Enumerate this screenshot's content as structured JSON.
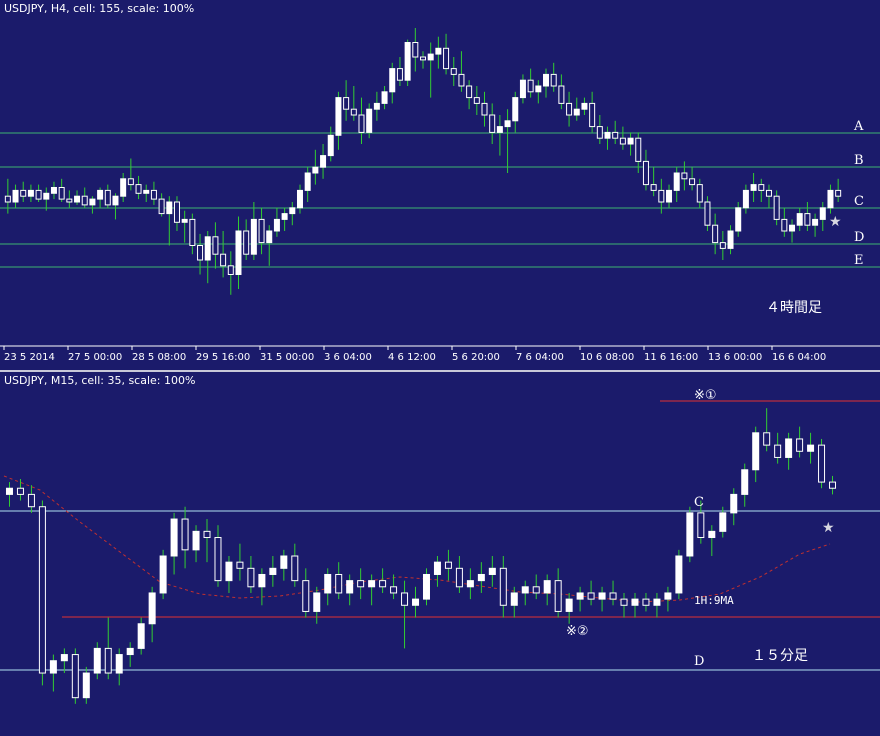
{
  "top": {
    "title": "USDJPY, H4, cell: 155, scale: 100%",
    "timeframe_label": "４時間足",
    "star": "★",
    "time_labels": [
      "23 5 2014",
      "27 5 00:00",
      "28 5 08:00",
      "29 5 16:00",
      "31 5 00:00",
      "3 6 04:00",
      "4 6 12:00",
      "5 6 20:00",
      "7 6 04:00",
      "10 6 08:00",
      "11 6 16:00",
      "13 6 00:00",
      "16 6 04:00"
    ],
    "levels": [
      {
        "label": "A",
        "color": "#3cb371"
      },
      {
        "label": "B",
        "color": "#3cb371"
      },
      {
        "label": "C",
        "color": "#3cb371"
      },
      {
        "label": "D",
        "color": "#3cb371"
      },
      {
        "label": "E",
        "color": "#3cb371"
      }
    ],
    "colors": {
      "up": "#ffffff",
      "down": "#ffffff",
      "wick": "#32cd32"
    }
  },
  "bottom": {
    "title": "USDJPY, M15, cell: 35, scale: 100%",
    "timeframe_label": "１５分足",
    "ma_label": "1H:9MA",
    "mark1": "※①",
    "mark2": "※②",
    "star": "★",
    "level_c": "C",
    "level_d": "D",
    "colors": {
      "level": "#b0e0f0",
      "red": "#e03030",
      "ma": "#c03030"
    }
  },
  "chart_data": [
    {
      "type": "candlestick",
      "title": "USDJPY, H4, cell: 155, scale: 100%",
      "x_tick_labels": [
        "23 5 2014",
        "27 5 00:00",
        "28 5 08:00",
        "29 5 16:00",
        "31 5 00:00",
        "3 6 04:00",
        "4 6 12:00",
        "5 6 20:00",
        "7 6 04:00",
        "10 6 08:00",
        "11 6 16:00",
        "13 6 00:00",
        "16 6 04:00"
      ],
      "horizontal_levels": [
        "A",
        "B",
        "C",
        "D",
        "E"
      ],
      "candles_ohlc_relative": [
        [
          0.42,
          0.48,
          0.36,
          0.4
        ],
        [
          0.4,
          0.46,
          0.38,
          0.44
        ],
        [
          0.44,
          0.47,
          0.4,
          0.42
        ],
        [
          0.42,
          0.46,
          0.4,
          0.44
        ],
        [
          0.44,
          0.46,
          0.4,
          0.41
        ],
        [
          0.41,
          0.45,
          0.37,
          0.43
        ],
        [
          0.43,
          0.47,
          0.41,
          0.45
        ],
        [
          0.45,
          0.48,
          0.4,
          0.41
        ],
        [
          0.41,
          0.44,
          0.38,
          0.4
        ],
        [
          0.4,
          0.44,
          0.39,
          0.42
        ],
        [
          0.42,
          0.45,
          0.38,
          0.39
        ],
        [
          0.39,
          0.42,
          0.36,
          0.41
        ],
        [
          0.41,
          0.45,
          0.38,
          0.44
        ],
        [
          0.44,
          0.46,
          0.38,
          0.39
        ],
        [
          0.39,
          0.43,
          0.34,
          0.42
        ],
        [
          0.42,
          0.5,
          0.4,
          0.48
        ],
        [
          0.48,
          0.55,
          0.44,
          0.46
        ],
        [
          0.46,
          0.49,
          0.41,
          0.43
        ],
        [
          0.43,
          0.46,
          0.4,
          0.44
        ],
        [
          0.44,
          0.47,
          0.39,
          0.41
        ],
        [
          0.41,
          0.43,
          0.35,
          0.36
        ],
        [
          0.36,
          0.42,
          0.25,
          0.4
        ],
        [
          0.4,
          0.42,
          0.3,
          0.33
        ],
        [
          0.33,
          0.37,
          0.26,
          0.34
        ],
        [
          0.34,
          0.36,
          0.22,
          0.25
        ],
        [
          0.25,
          0.29,
          0.15,
          0.2
        ],
        [
          0.2,
          0.3,
          0.12,
          0.28
        ],
        [
          0.28,
          0.33,
          0.17,
          0.22
        ],
        [
          0.22,
          0.3,
          0.14,
          0.18
        ],
        [
          0.18,
          0.23,
          0.08,
          0.15
        ],
        [
          0.15,
          0.35,
          0.1,
          0.3
        ],
        [
          0.3,
          0.34,
          0.2,
          0.22
        ],
        [
          0.22,
          0.4,
          0.2,
          0.34
        ],
        [
          0.34,
          0.38,
          0.22,
          0.26
        ],
        [
          0.26,
          0.32,
          0.18,
          0.3
        ],
        [
          0.3,
          0.38,
          0.28,
          0.34
        ],
        [
          0.34,
          0.38,
          0.3,
          0.36
        ],
        [
          0.36,
          0.4,
          0.32,
          0.38
        ],
        [
          0.38,
          0.46,
          0.36,
          0.44
        ],
        [
          0.44,
          0.52,
          0.4,
          0.5
        ],
        [
          0.5,
          0.58,
          0.46,
          0.52
        ],
        [
          0.52,
          0.6,
          0.48,
          0.56
        ],
        [
          0.56,
          0.66,
          0.54,
          0.63
        ],
        [
          0.63,
          0.78,
          0.58,
          0.76
        ],
        [
          0.76,
          0.82,
          0.68,
          0.72
        ],
        [
          0.72,
          0.8,
          0.68,
          0.7
        ],
        [
          0.7,
          0.76,
          0.6,
          0.64
        ],
        [
          0.64,
          0.74,
          0.62,
          0.72
        ],
        [
          0.72,
          0.78,
          0.68,
          0.74
        ],
        [
          0.74,
          0.8,
          0.72,
          0.78
        ],
        [
          0.78,
          0.88,
          0.74,
          0.86
        ],
        [
          0.86,
          0.9,
          0.8,
          0.82
        ],
        [
          0.82,
          0.96,
          0.8,
          0.95
        ],
        [
          0.95,
          1.0,
          0.85,
          0.9
        ],
        [
          0.9,
          0.92,
          0.86,
          0.89
        ],
        [
          0.89,
          0.95,
          0.76,
          0.91
        ],
        [
          0.91,
          0.97,
          0.86,
          0.93
        ],
        [
          0.93,
          0.98,
          0.84,
          0.86
        ],
        [
          0.86,
          0.9,
          0.8,
          0.84
        ],
        [
          0.84,
          0.92,
          0.78,
          0.8
        ],
        [
          0.8,
          0.82,
          0.72,
          0.76
        ],
        [
          0.76,
          0.8,
          0.7,
          0.74
        ],
        [
          0.74,
          0.78,
          0.66,
          0.7
        ],
        [
          0.7,
          0.74,
          0.6,
          0.64
        ],
        [
          0.64,
          0.7,
          0.56,
          0.66
        ],
        [
          0.66,
          0.72,
          0.5,
          0.68
        ],
        [
          0.68,
          0.78,
          0.64,
          0.76
        ],
        [
          0.76,
          0.84,
          0.74,
          0.82
        ],
        [
          0.82,
          0.86,
          0.76,
          0.78
        ],
        [
          0.78,
          0.82,
          0.74,
          0.8
        ],
        [
          0.8,
          0.86,
          0.76,
          0.84
        ],
        [
          0.84,
          0.88,
          0.78,
          0.8
        ],
        [
          0.8,
          0.84,
          0.72,
          0.74
        ],
        [
          0.74,
          0.78,
          0.66,
          0.7
        ],
        [
          0.7,
          0.76,
          0.68,
          0.72
        ],
        [
          0.72,
          0.76,
          0.7,
          0.74
        ],
        [
          0.74,
          0.78,
          0.64,
          0.66
        ],
        [
          0.66,
          0.7,
          0.6,
          0.62
        ],
        [
          0.62,
          0.66,
          0.58,
          0.64
        ],
        [
          0.64,
          0.68,
          0.6,
          0.62
        ],
        [
          0.62,
          0.66,
          0.58,
          0.6
        ],
        [
          0.6,
          0.64,
          0.56,
          0.62
        ],
        [
          0.62,
          0.64,
          0.5,
          0.54
        ],
        [
          0.54,
          0.58,
          0.44,
          0.46
        ],
        [
          0.46,
          0.52,
          0.42,
          0.44
        ],
        [
          0.44,
          0.48,
          0.36,
          0.4
        ],
        [
          0.4,
          0.46,
          0.38,
          0.44
        ],
        [
          0.44,
          0.52,
          0.4,
          0.5
        ],
        [
          0.5,
          0.54,
          0.44,
          0.48
        ],
        [
          0.48,
          0.52,
          0.44,
          0.46
        ],
        [
          0.46,
          0.48,
          0.38,
          0.4
        ],
        [
          0.4,
          0.42,
          0.3,
          0.32
        ],
        [
          0.32,
          0.36,
          0.22,
          0.26
        ],
        [
          0.26,
          0.3,
          0.2,
          0.24
        ],
        [
          0.24,
          0.32,
          0.22,
          0.3
        ],
        [
          0.3,
          0.4,
          0.28,
          0.38
        ],
        [
          0.38,
          0.46,
          0.36,
          0.44
        ],
        [
          0.44,
          0.5,
          0.4,
          0.46
        ],
        [
          0.46,
          0.48,
          0.4,
          0.44
        ],
        [
          0.44,
          0.46,
          0.38,
          0.42
        ],
        [
          0.42,
          0.44,
          0.32,
          0.34
        ],
        [
          0.34,
          0.38,
          0.28,
          0.3
        ],
        [
          0.3,
          0.34,
          0.26,
          0.32
        ],
        [
          0.32,
          0.38,
          0.3,
          0.36
        ],
        [
          0.36,
          0.4,
          0.3,
          0.32
        ],
        [
          0.32,
          0.36,
          0.28,
          0.34
        ],
        [
          0.34,
          0.4,
          0.3,
          0.38
        ],
        [
          0.38,
          0.46,
          0.36,
          0.44
        ],
        [
          0.44,
          0.48,
          0.4,
          0.42
        ]
      ]
    },
    {
      "type": "candlestick",
      "title": "USDJPY, M15, cell: 35, scale: 100%",
      "annotations": [
        "※①",
        "※②",
        "1H:9MA",
        "C",
        "D",
        "★",
        "１５分足"
      ],
      "candles_ohlc_relative": [
        [
          0.7,
          0.74,
          0.66,
          0.72
        ],
        [
          0.72,
          0.75,
          0.68,
          0.7
        ],
        [
          0.7,
          0.73,
          0.64,
          0.66
        ],
        [
          0.66,
          0.68,
          0.08,
          0.12
        ],
        [
          0.12,
          0.18,
          0.06,
          0.16
        ],
        [
          0.16,
          0.2,
          0.12,
          0.18
        ],
        [
          0.18,
          0.2,
          0.02,
          0.04
        ],
        [
          0.04,
          0.14,
          0.02,
          0.12
        ],
        [
          0.12,
          0.22,
          0.1,
          0.2
        ],
        [
          0.2,
          0.3,
          0.1,
          0.12
        ],
        [
          0.12,
          0.2,
          0.08,
          0.18
        ],
        [
          0.18,
          0.22,
          0.14,
          0.2
        ],
        [
          0.2,
          0.3,
          0.18,
          0.28
        ],
        [
          0.28,
          0.4,
          0.22,
          0.38
        ],
        [
          0.38,
          0.52,
          0.36,
          0.5
        ],
        [
          0.5,
          0.64,
          0.44,
          0.62
        ],
        [
          0.62,
          0.66,
          0.46,
          0.52
        ],
        [
          0.52,
          0.6,
          0.48,
          0.58
        ],
        [
          0.58,
          0.62,
          0.48,
          0.56
        ],
        [
          0.56,
          0.6,
          0.4,
          0.42
        ],
        [
          0.42,
          0.5,
          0.38,
          0.48
        ],
        [
          0.48,
          0.54,
          0.42,
          0.46
        ],
        [
          0.46,
          0.5,
          0.38,
          0.4
        ],
        [
          0.4,
          0.46,
          0.34,
          0.44
        ],
        [
          0.44,
          0.5,
          0.4,
          0.46
        ],
        [
          0.46,
          0.52,
          0.42,
          0.5
        ],
        [
          0.5,
          0.54,
          0.4,
          0.42
        ],
        [
          0.42,
          0.46,
          0.3,
          0.32
        ],
        [
          0.32,
          0.4,
          0.28,
          0.38
        ],
        [
          0.38,
          0.46,
          0.34,
          0.44
        ],
        [
          0.44,
          0.48,
          0.36,
          0.38
        ],
        [
          0.38,
          0.44,
          0.34,
          0.42
        ],
        [
          0.42,
          0.46,
          0.36,
          0.4
        ],
        [
          0.4,
          0.44,
          0.34,
          0.42
        ],
        [
          0.42,
          0.46,
          0.38,
          0.4
        ],
        [
          0.4,
          0.44,
          0.36,
          0.38
        ],
        [
          0.38,
          0.42,
          0.2,
          0.34
        ],
        [
          0.34,
          0.4,
          0.3,
          0.36
        ],
        [
          0.36,
          0.46,
          0.34,
          0.44
        ],
        [
          0.44,
          0.5,
          0.4,
          0.48
        ],
        [
          0.48,
          0.52,
          0.42,
          0.46
        ],
        [
          0.46,
          0.5,
          0.38,
          0.4
        ],
        [
          0.4,
          0.46,
          0.36,
          0.42
        ],
        [
          0.42,
          0.48,
          0.38,
          0.44
        ],
        [
          0.44,
          0.5,
          0.4,
          0.46
        ],
        [
          0.46,
          0.5,
          0.3,
          0.34
        ],
        [
          0.34,
          0.4,
          0.3,
          0.38
        ],
        [
          0.38,
          0.42,
          0.34,
          0.4
        ],
        [
          0.4,
          0.44,
          0.36,
          0.38
        ],
        [
          0.38,
          0.44,
          0.34,
          0.42
        ],
        [
          0.42,
          0.46,
          0.3,
          0.32
        ],
        [
          0.32,
          0.38,
          0.28,
          0.36
        ],
        [
          0.36,
          0.4,
          0.32,
          0.38
        ],
        [
          0.38,
          0.42,
          0.34,
          0.36
        ],
        [
          0.36,
          0.4,
          0.32,
          0.38
        ],
        [
          0.38,
          0.42,
          0.34,
          0.36
        ],
        [
          0.36,
          0.38,
          0.3,
          0.34
        ],
        [
          0.34,
          0.38,
          0.3,
          0.36
        ],
        [
          0.36,
          0.38,
          0.32,
          0.34
        ],
        [
          0.34,
          0.38,
          0.3,
          0.36
        ],
        [
          0.36,
          0.4,
          0.32,
          0.38
        ],
        [
          0.38,
          0.52,
          0.36,
          0.5
        ],
        [
          0.5,
          0.66,
          0.48,
          0.64
        ],
        [
          0.64,
          0.68,
          0.54,
          0.56
        ],
        [
          0.56,
          0.6,
          0.5,
          0.58
        ],
        [
          0.58,
          0.66,
          0.56,
          0.64
        ],
        [
          0.64,
          0.72,
          0.6,
          0.7
        ],
        [
          0.7,
          0.8,
          0.66,
          0.78
        ],
        [
          0.78,
          0.92,
          0.74,
          0.9
        ],
        [
          0.9,
          0.98,
          0.84,
          0.86
        ],
        [
          0.86,
          0.9,
          0.8,
          0.82
        ],
        [
          0.82,
          0.9,
          0.78,
          0.88
        ],
        [
          0.88,
          0.92,
          0.82,
          0.84
        ],
        [
          0.84,
          0.9,
          0.8,
          0.86
        ],
        [
          0.86,
          0.88,
          0.72,
          0.74
        ],
        [
          0.74,
          0.76,
          0.7,
          0.72
        ]
      ]
    }
  ]
}
